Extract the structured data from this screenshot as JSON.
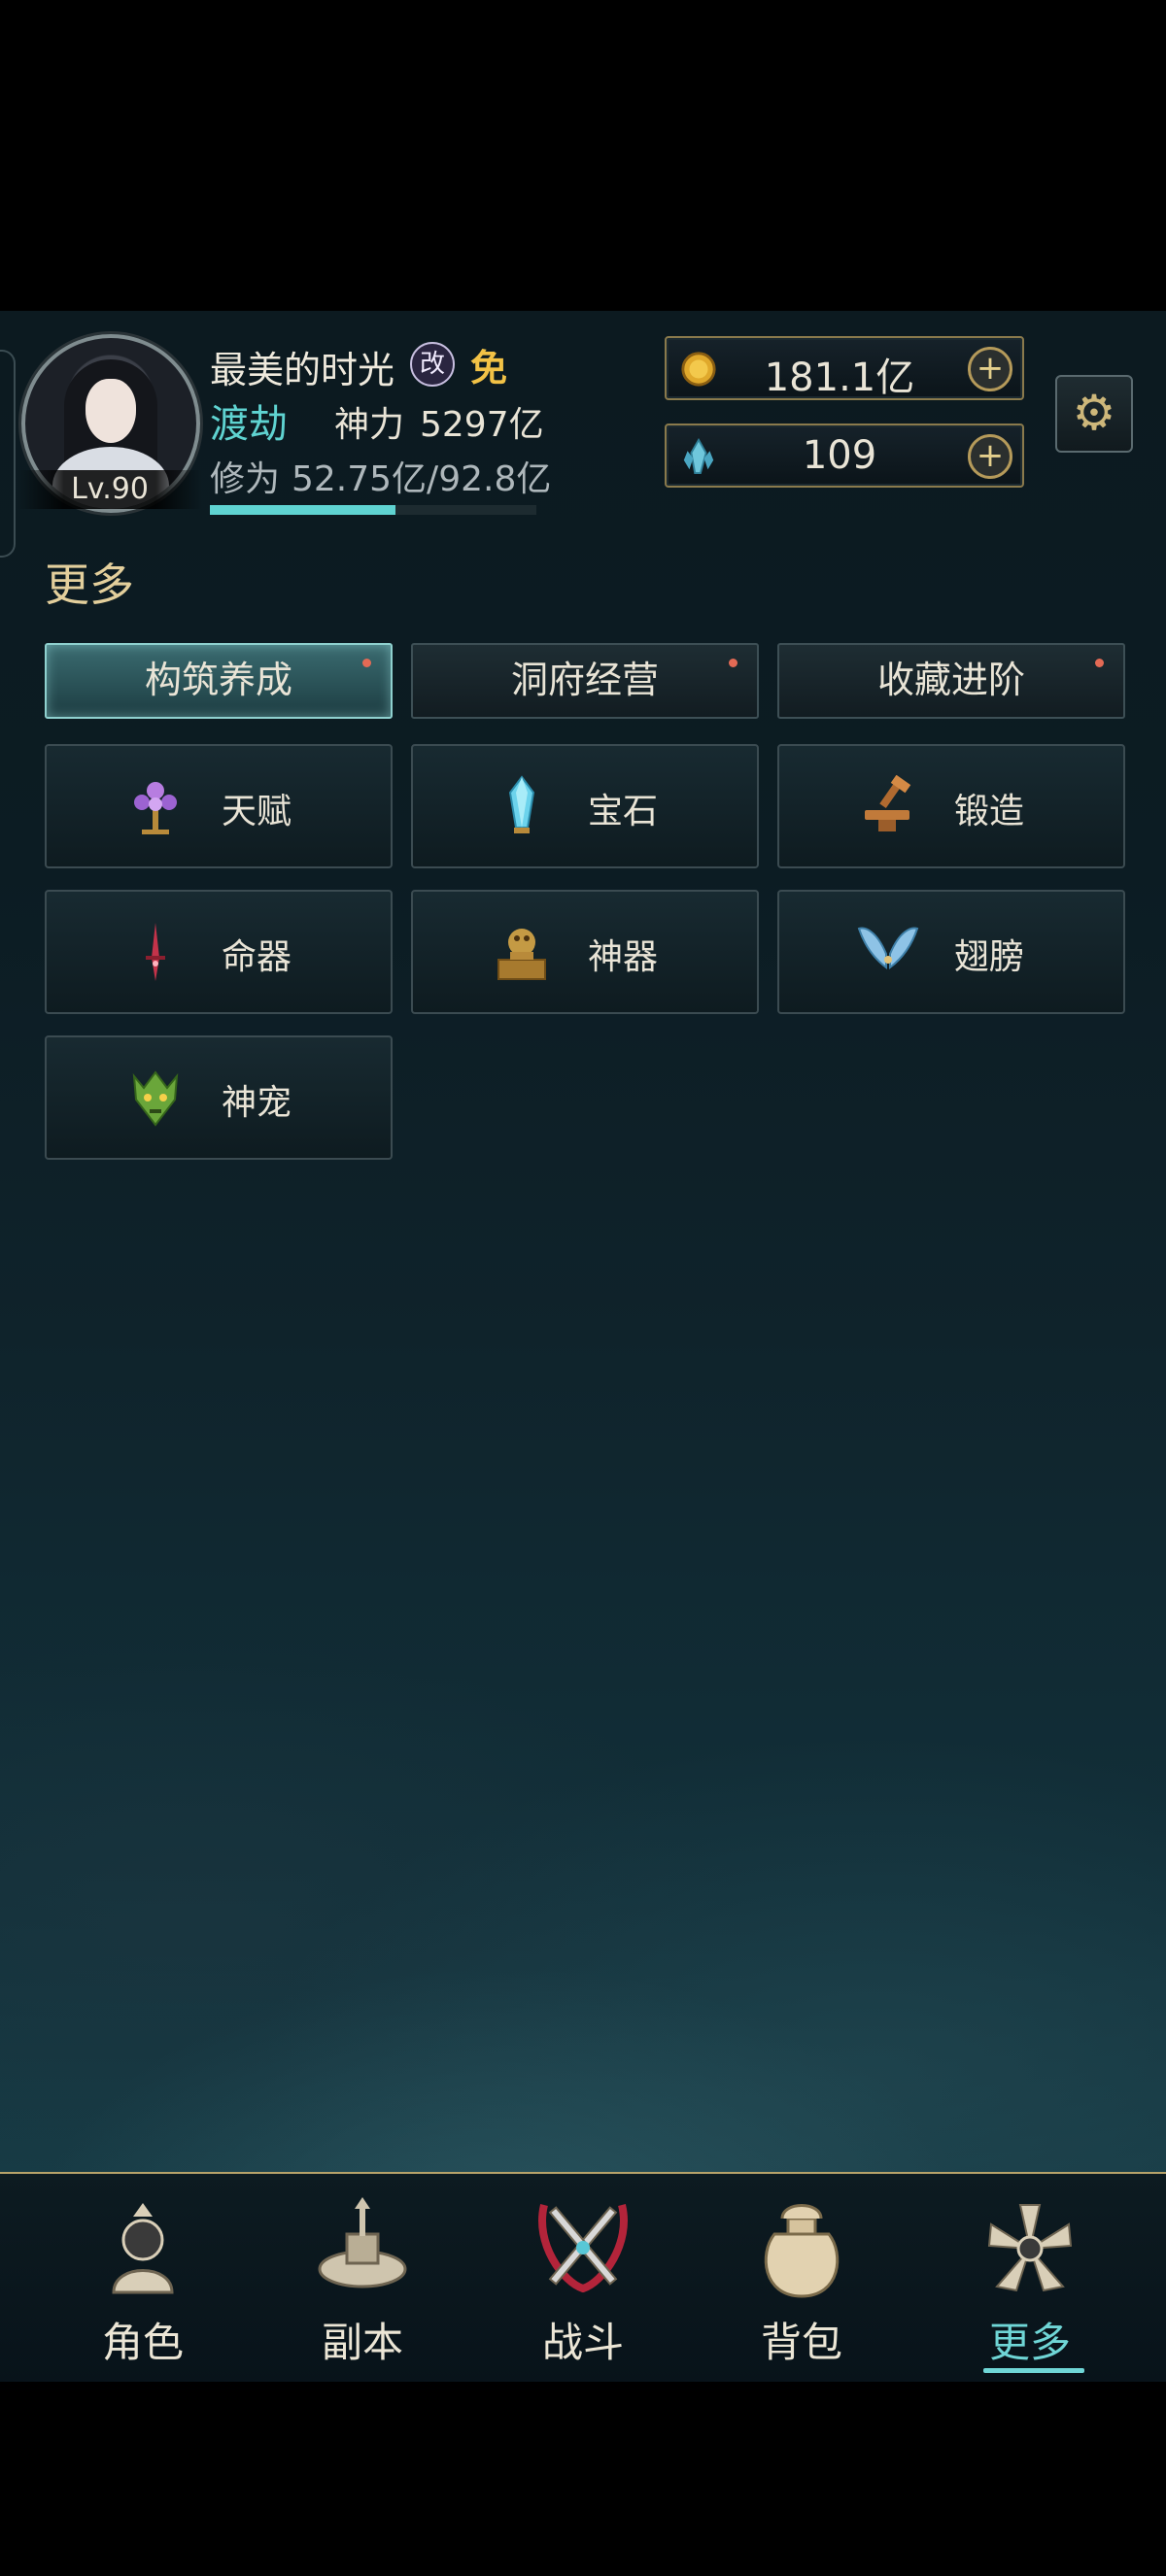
{
  "player": {
    "level": "Lv.90",
    "name": "最美的时光",
    "badge_change": "改",
    "badge_free": "免",
    "realm": "渡劫",
    "power_label": "神力",
    "power_value": "5297亿",
    "cultivation_label": "修为",
    "cultivation_value": "52.75亿/92.8亿",
    "cultivation_progress": 0.5685
  },
  "currencies": [
    {
      "icon": "gold-coin-icon",
      "amount": "181.1亿"
    },
    {
      "icon": "crystal-icon",
      "amount": "109"
    }
  ],
  "section_title": "更多",
  "tabs": [
    {
      "label": "构筑养成",
      "active": true,
      "red_dot": true
    },
    {
      "label": "洞府经营",
      "active": false,
      "red_dot": true
    },
    {
      "label": "收藏进阶",
      "active": false,
      "red_dot": true
    }
  ],
  "features": [
    {
      "label": "天赋",
      "icon": "talent-tree-icon"
    },
    {
      "label": "宝石",
      "icon": "gem-icon"
    },
    {
      "label": "锻造",
      "icon": "forge-anvil-icon"
    },
    {
      "label": "命器",
      "icon": "life-artifact-dagger-icon"
    },
    {
      "label": "神器",
      "icon": "divine-seal-icon"
    },
    {
      "label": "翅膀",
      "icon": "wings-icon"
    },
    {
      "label": "神宠",
      "icon": "dragon-pet-icon"
    }
  ],
  "nav": [
    {
      "label": "角色",
      "icon": "character-icon",
      "active": false
    },
    {
      "label": "副本",
      "icon": "dungeon-icon",
      "active": false
    },
    {
      "label": "战斗",
      "icon": "battle-swords-icon",
      "active": false
    },
    {
      "label": "背包",
      "icon": "bag-icon",
      "active": false
    },
    {
      "label": "更多",
      "icon": "more-lotus-icon",
      "active": true
    }
  ],
  "colors": {
    "accent_teal": "#5fd3d1",
    "gold": "#e3cf9c",
    "red_dot": "#e36a55"
  }
}
